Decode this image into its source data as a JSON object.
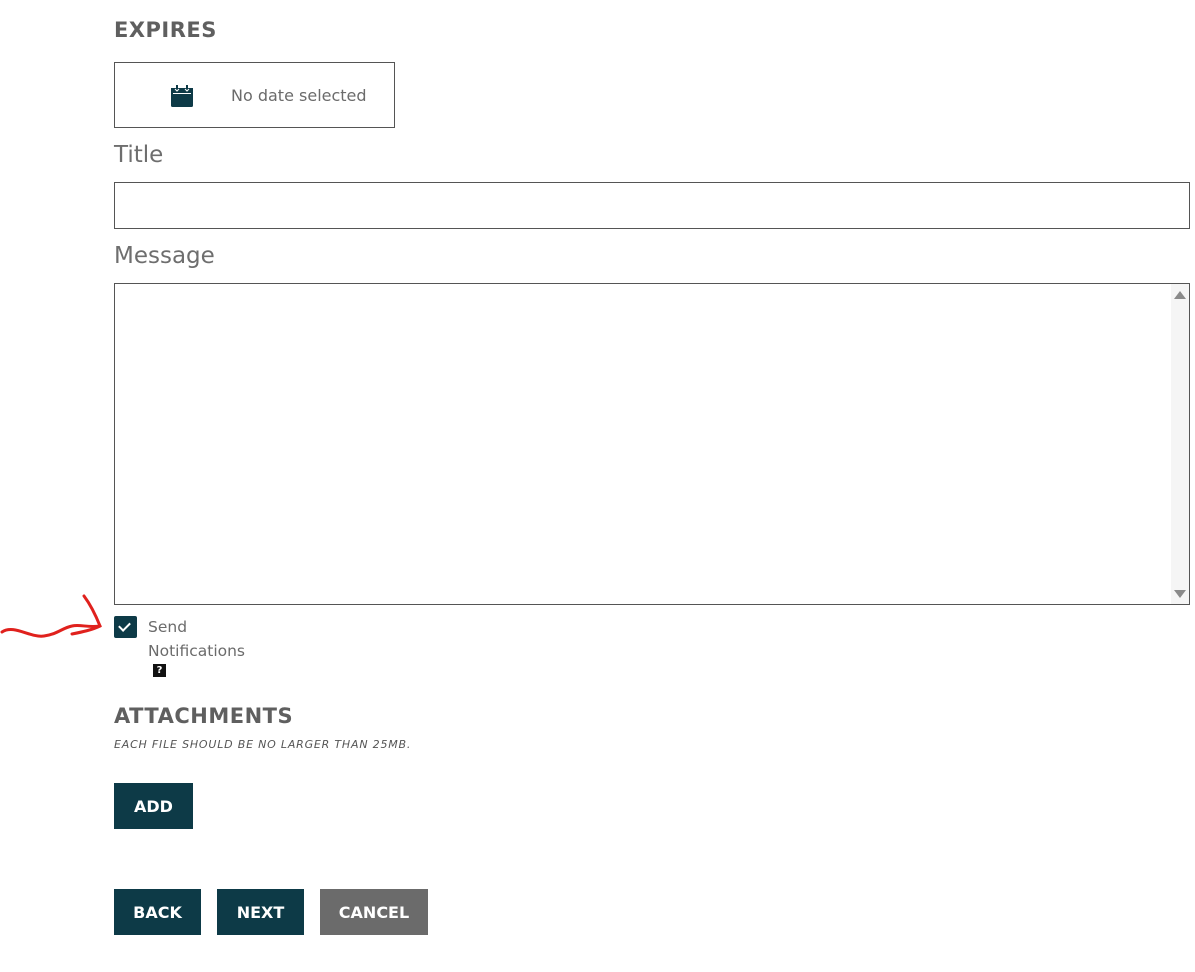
{
  "expires": {
    "heading": "EXPIRES",
    "date_text": "No date selected",
    "icon": "calendar-icon"
  },
  "title": {
    "label": "Title",
    "value": ""
  },
  "message": {
    "label": "Message",
    "value": ""
  },
  "notifications": {
    "checked": true,
    "label_line1": "Send",
    "label_line2": "Notifications",
    "help_glyph": "?"
  },
  "attachments": {
    "heading": "ATTACHMENTS",
    "note": "EACH FILE SHOULD BE NO LARGER THAN 25MB.",
    "add_label": "ADD"
  },
  "actions": {
    "back_label": "BACK",
    "next_label": "NEXT",
    "cancel_label": "CANCEL"
  },
  "colors": {
    "primary": "#0d3a47",
    "secondary": "#6b6b6b",
    "annotation": "#e0211d"
  }
}
